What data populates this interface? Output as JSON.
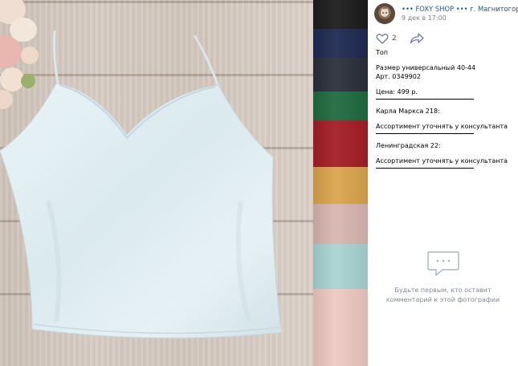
{
  "post": {
    "author": "••• FOXY SHOP ••• г. Магнитогорск",
    "date": "9 дек в 17:00",
    "likes": "2"
  },
  "description": {
    "title": "Топ",
    "size": "Размер универсальный 40-44",
    "article": "Арт. 0349902",
    "price": "Цена: 499 р.",
    "store1": "Карла Маркса 218:",
    "store1_note": "Ассортимент уточнять у консультанта",
    "store2": "Ленинградская 22:",
    "store2_note": "Ассортимент уточнять у консультанта"
  },
  "comments": {
    "empty_line1": "Будьте первым, кто оставит",
    "empty_line2": "комментарий к этой фотографии"
  },
  "colors": {
    "link": "#2a5885",
    "swatches": [
      "#1c1c1c",
      "#1f2a52",
      "#2a2f3b",
      "#1e6b3f",
      "#a51d27",
      "#d9a54e",
      "#d8b6b0",
      "#a8d4d2",
      "#efc9c3"
    ]
  },
  "icons": [
    "avatar-icon",
    "heart-icon",
    "share-arrow-icon",
    "comment-bubble-icon"
  ]
}
